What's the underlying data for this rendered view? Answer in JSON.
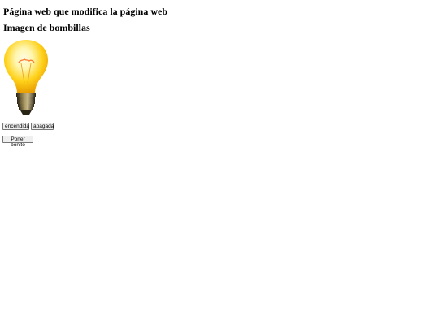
{
  "page": {
    "title": "Página web que modifica la página web",
    "subtitle": "Imagen de bombillas"
  },
  "image": {
    "icon": "lightbulb-icon",
    "state": "on",
    "colors": {
      "glass_light": "#fff6b0",
      "glass_mid": "#ffd21a",
      "glass_dark": "#e79b00",
      "filament": "#ff7a33",
      "base_light": "#9a8a55",
      "base_dark": "#2a2416"
    }
  },
  "buttons": {
    "on_label": "encendida",
    "off_label": "apagada",
    "pretty_label": "Poner bonito"
  }
}
